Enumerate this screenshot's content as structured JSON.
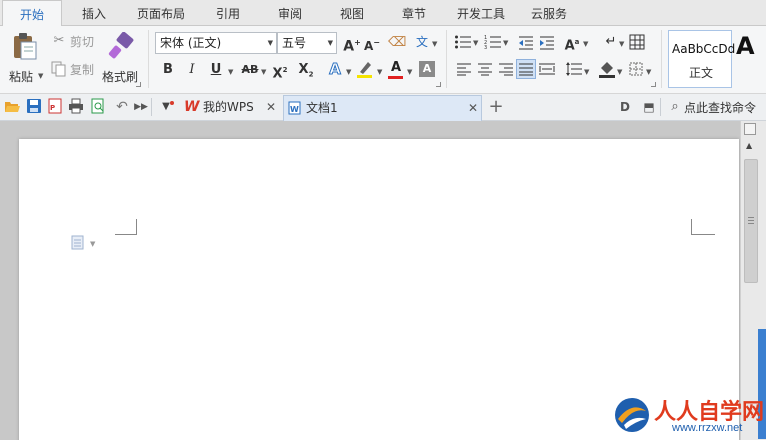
{
  "menu": {
    "tabs": [
      "开始",
      "插入",
      "页面布局",
      "引用",
      "审阅",
      "视图",
      "章节",
      "开发工具",
      "云服务"
    ],
    "active_index": 0
  },
  "ribbon": {
    "paste_label": "粘贴",
    "cut_label": "剪切",
    "copy_label": "复制",
    "format_painter_label": "格式刷",
    "font_name": "宋体 (正文)",
    "font_size": "五号",
    "style_preview": "AaBbCcDd",
    "style_name": "正文",
    "style_next_preview": "A"
  },
  "quickbar": {
    "tabs": [
      {
        "label": "我的WPS",
        "active": false
      },
      {
        "label": "文档1",
        "active": true
      }
    ],
    "search_label": "点此查找命令"
  },
  "watermark": {
    "main": "人人自学网",
    "url": "www.rrzxw.net"
  },
  "colors": {
    "accent": "#2a6fbf",
    "wps_red": "#d83a2a",
    "font_color_red": "#e02020",
    "highlight_yellow": "#f5e400",
    "scroll_blue": "#3b7fd0"
  }
}
